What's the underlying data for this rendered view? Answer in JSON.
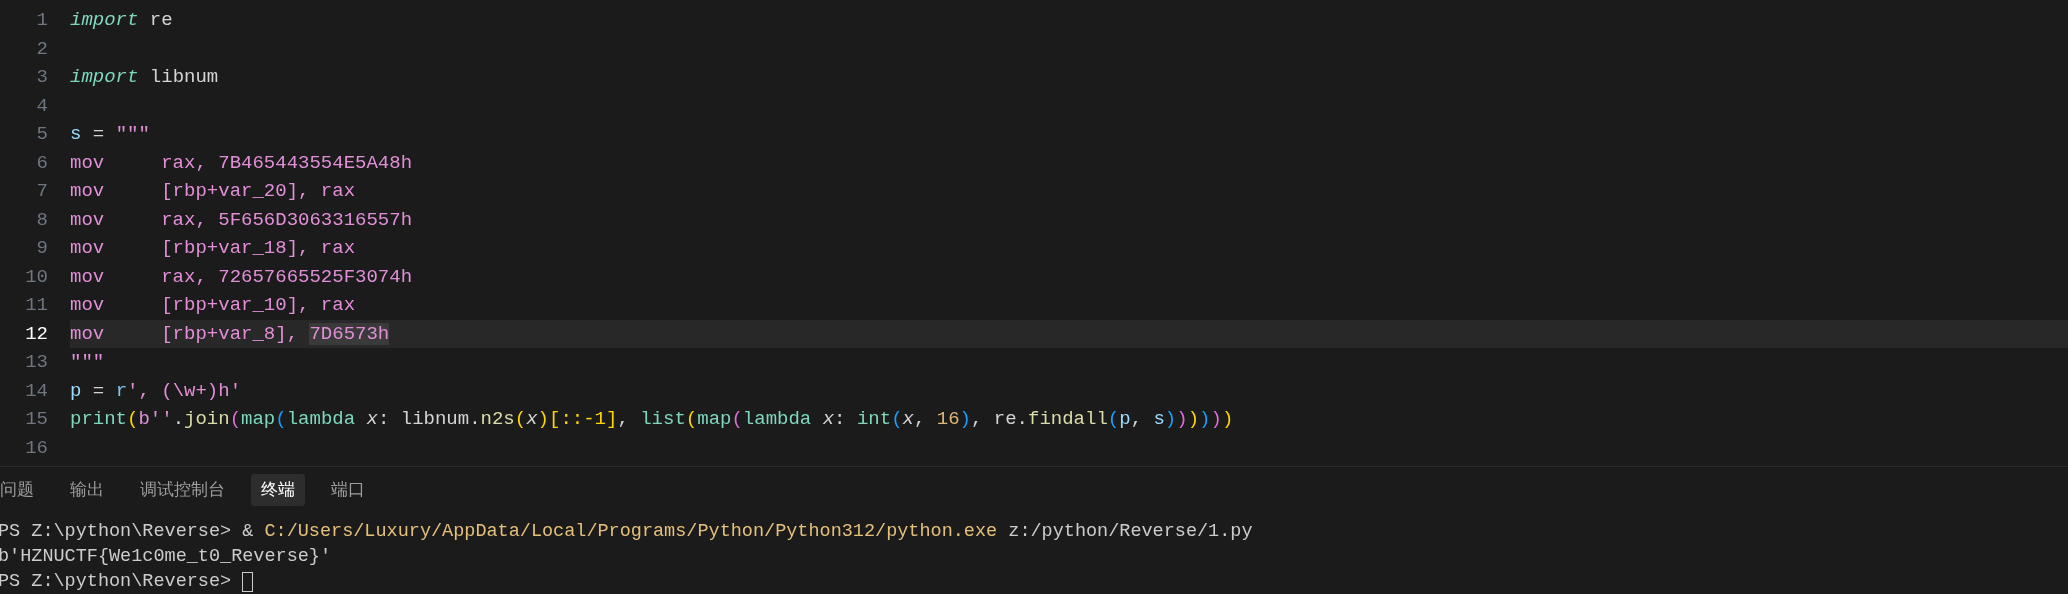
{
  "editor": {
    "lines": [
      {
        "number": "1",
        "current": false,
        "tokens": [
          {
            "text": "import",
            "kind": "kw"
          },
          {
            "text": " re",
            "kind": "plain"
          }
        ]
      },
      {
        "number": "2",
        "current": false
      },
      {
        "number": "3",
        "current": false,
        "tokens": [
          {
            "text": "import",
            "kind": "kw"
          },
          {
            "text": " libnum",
            "kind": "plain"
          }
        ]
      },
      {
        "number": "4",
        "current": false
      },
      {
        "number": "5",
        "current": false,
        "tokens": [
          {
            "text": "s",
            "kind": "var"
          },
          {
            "text": " = ",
            "kind": "plain"
          },
          {
            "text": "\"\"\"",
            "kind": "str"
          }
        ]
      },
      {
        "number": "6",
        "current": false,
        "tokens": [
          {
            "text": "mov     rax, 7B465443554E5A48h",
            "kind": "str"
          }
        ]
      },
      {
        "number": "7",
        "current": false,
        "tokens": [
          {
            "text": "mov     [rbp+var_20], rax",
            "kind": "str"
          }
        ]
      },
      {
        "number": "8",
        "current": false,
        "tokens": [
          {
            "text": "mov     rax, 5F656D3063316557h",
            "kind": "str"
          }
        ]
      },
      {
        "number": "9",
        "current": false,
        "tokens": [
          {
            "text": "mov     [rbp+var_18], rax",
            "kind": "str"
          }
        ]
      },
      {
        "number": "10",
        "current": false,
        "tokens": [
          {
            "text": "mov     rax, 72657665525F3074h",
            "kind": "str"
          }
        ]
      },
      {
        "number": "11",
        "current": false,
        "tokens": [
          {
            "text": "mov     [rbp+var_10], rax",
            "kind": "str"
          }
        ]
      },
      {
        "number": "12",
        "current": true,
        "tokens": [
          {
            "text": "mov     [rbp+var_8], ",
            "kind": "str"
          },
          {
            "text": "7D6573h",
            "kind": "match"
          }
        ]
      },
      {
        "number": "13",
        "current": false,
        "tokens": [
          {
            "text": "\"\"\"",
            "kind": "str"
          }
        ]
      },
      {
        "number": "14",
        "current": false,
        "tokens": [
          {
            "text": "p",
            "kind": "var"
          },
          {
            "text": " = ",
            "kind": "plain"
          },
          {
            "text": "r",
            "kind": "prefix"
          },
          {
            "text": "', (\\w+)h'",
            "kind": "str"
          }
        ]
      },
      {
        "number": "15",
        "current": false,
        "tokens": [
          {
            "text": "print",
            "kind": "fn"
          },
          {
            "text": "(",
            "kind": "b1"
          },
          {
            "text": "b''",
            "kind": "str"
          },
          {
            "text": ".",
            "kind": "plain"
          },
          {
            "text": "join",
            "kind": "method"
          },
          {
            "text": "(",
            "kind": "b2"
          },
          {
            "text": "map",
            "kind": "fn"
          },
          {
            "text": "(",
            "kind": "b3"
          },
          {
            "text": "lambda ",
            "kind": "fn"
          },
          {
            "text": "x",
            "kind": "param"
          },
          {
            "text": ": libnum.",
            "kind": "plain"
          },
          {
            "text": "n2s",
            "kind": "method"
          },
          {
            "text": "(",
            "kind": "b1"
          },
          {
            "text": "x",
            "kind": "param"
          },
          {
            "text": ")",
            "kind": "b1"
          },
          {
            "text": "[::-1]",
            "kind": "b1"
          },
          {
            "text": ", ",
            "kind": "plain"
          },
          {
            "text": "list",
            "kind": "fn"
          },
          {
            "text": "(",
            "kind": "b1"
          },
          {
            "text": "map",
            "kind": "fn"
          },
          {
            "text": "(",
            "kind": "b2"
          },
          {
            "text": "lambda ",
            "kind": "fn"
          },
          {
            "text": "x",
            "kind": "param"
          },
          {
            "text": ": ",
            "kind": "plain"
          },
          {
            "text": "int",
            "kind": "fn"
          },
          {
            "text": "(",
            "kind": "b3"
          },
          {
            "text": "x",
            "kind": "param"
          },
          {
            "text": ", ",
            "kind": "plain"
          },
          {
            "text": "16",
            "kind": "num"
          },
          {
            "text": ")",
            "kind": "b3"
          },
          {
            "text": ", re.",
            "kind": "plain"
          },
          {
            "text": "findall",
            "kind": "method"
          },
          {
            "text": "(",
            "kind": "b3"
          },
          {
            "text": "p",
            "kind": "var"
          },
          {
            "text": ", ",
            "kind": "plain"
          },
          {
            "text": "s",
            "kind": "var"
          },
          {
            "text": ")",
            "kind": "b3"
          },
          {
            "text": ")",
            "kind": "b2"
          },
          {
            "text": ")",
            "kind": "b1"
          },
          {
            "text": ")",
            "kind": "b3"
          },
          {
            "text": ")",
            "kind": "b2"
          },
          {
            "text": ")",
            "kind": "b1"
          }
        ]
      },
      {
        "number": "16",
        "current": false
      }
    ]
  },
  "panel": {
    "tabs": [
      {
        "label": "问题",
        "selected": false
      },
      {
        "label": "输出",
        "selected": false
      },
      {
        "label": "调试控制台",
        "selected": false
      },
      {
        "label": "终端",
        "selected": true
      },
      {
        "label": "端口",
        "selected": false
      }
    ]
  },
  "terminal": {
    "lines": [
      {
        "segments": [
          {
            "text": "PS Z:\\python\\Reverse> & ",
            "kind": "plain"
          },
          {
            "text": "C:/Users/Luxury/AppData/Local/Programs/Python/Python312/python.exe",
            "kind": "path"
          },
          {
            "text": " z:/python/Reverse/1.py",
            "kind": "plain"
          }
        ]
      },
      {
        "segments": [
          {
            "text": "b'HZNUCTF{We1c0me_t0_Reverse}'",
            "kind": "plain"
          }
        ]
      },
      {
        "segments": [
          {
            "text": "PS Z:\\python\\Reverse> ",
            "kind": "plain"
          }
        ],
        "cursor": true
      }
    ]
  }
}
